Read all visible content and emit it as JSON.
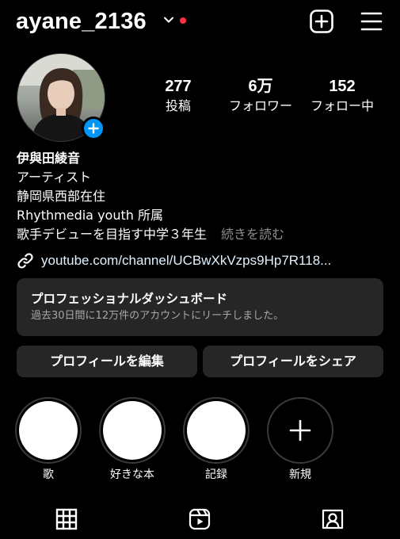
{
  "header": {
    "username": "ayane_2136",
    "icons": [
      "chevron-down-icon",
      "notification-dot",
      "new-post-icon",
      "hamburger-menu-icon"
    ],
    "notification_dot_color": "#ff3040"
  },
  "profile": {
    "avatar_alt": "profile photo",
    "add_story_color": "#0095f6",
    "stats": [
      {
        "value": "277",
        "label": "投稿"
      },
      {
        "value": "6万",
        "label": "フォロワー"
      },
      {
        "value": "152",
        "label": "フォロー中"
      }
    ]
  },
  "bio": {
    "name": "伊與田綾音",
    "lines": [
      "アーティスト",
      "静岡県西部在住",
      "Rhythmedia youth 所属",
      "歌手デビューを目指す中学３年生"
    ],
    "more": "続きを読む",
    "link": "youtube.com/channel/UCBwXkVzps9Hp7R118..."
  },
  "dashboard": {
    "title": "プロフェッショナルダッシュボード",
    "subtitle": "過去30日間に12万件のアカウントにリーチしました。"
  },
  "buttons": {
    "edit_profile": "プロフィールを編集",
    "share_profile": "プロフィールをシェア"
  },
  "highlights": [
    {
      "label": "歌"
    },
    {
      "label": "好きな本"
    },
    {
      "label": "記録"
    },
    {
      "label": "新規"
    }
  ],
  "tabs": [
    "grid-icon",
    "reels-icon",
    "tagged-icon"
  ],
  "colors": {
    "background": "#000000",
    "surface": "#262626",
    "secondary_text": "#a8a8a8",
    "link_text": "#e0f1ff"
  }
}
